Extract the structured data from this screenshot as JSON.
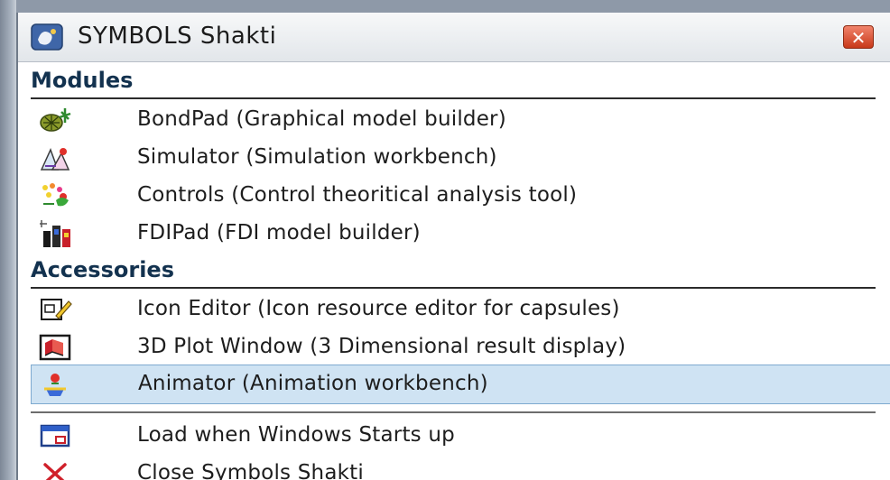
{
  "window": {
    "title": "SYMBOLS Shakti",
    "close_glyph": "✕"
  },
  "modules": {
    "header": "Modules",
    "items": [
      {
        "label": "BondPad (Graphical model builder)",
        "icon": "bondpad-icon"
      },
      {
        "label": "Simulator (Simulation workbench)",
        "icon": "simulator-icon"
      },
      {
        "label": "Controls (Control theoritical analysis tool)",
        "icon": "controls-icon"
      },
      {
        "label": "FDIPad (FDI model builder)",
        "icon": "fdipad-icon"
      }
    ]
  },
  "accessories": {
    "header": "Accessories",
    "items": [
      {
        "label": "Icon Editor (Icon resource editor for capsules)",
        "icon": "icon-editor-icon"
      },
      {
        "label": "3D Plot Window (3 Dimensional result display)",
        "icon": "3d-plot-icon"
      },
      {
        "label": "Animator (Animation workbench)",
        "icon": "animator-icon",
        "selected": true
      }
    ]
  },
  "system": {
    "items": [
      {
        "label": "Load when Windows Starts up",
        "icon": "window-startup-icon"
      },
      {
        "label": "Close Symbols Shakti",
        "icon": "close-x-icon"
      }
    ]
  },
  "colors": {
    "selection_bg": "#cfe3f3",
    "header_text": "#13324f",
    "close_button": "#c8391a"
  }
}
